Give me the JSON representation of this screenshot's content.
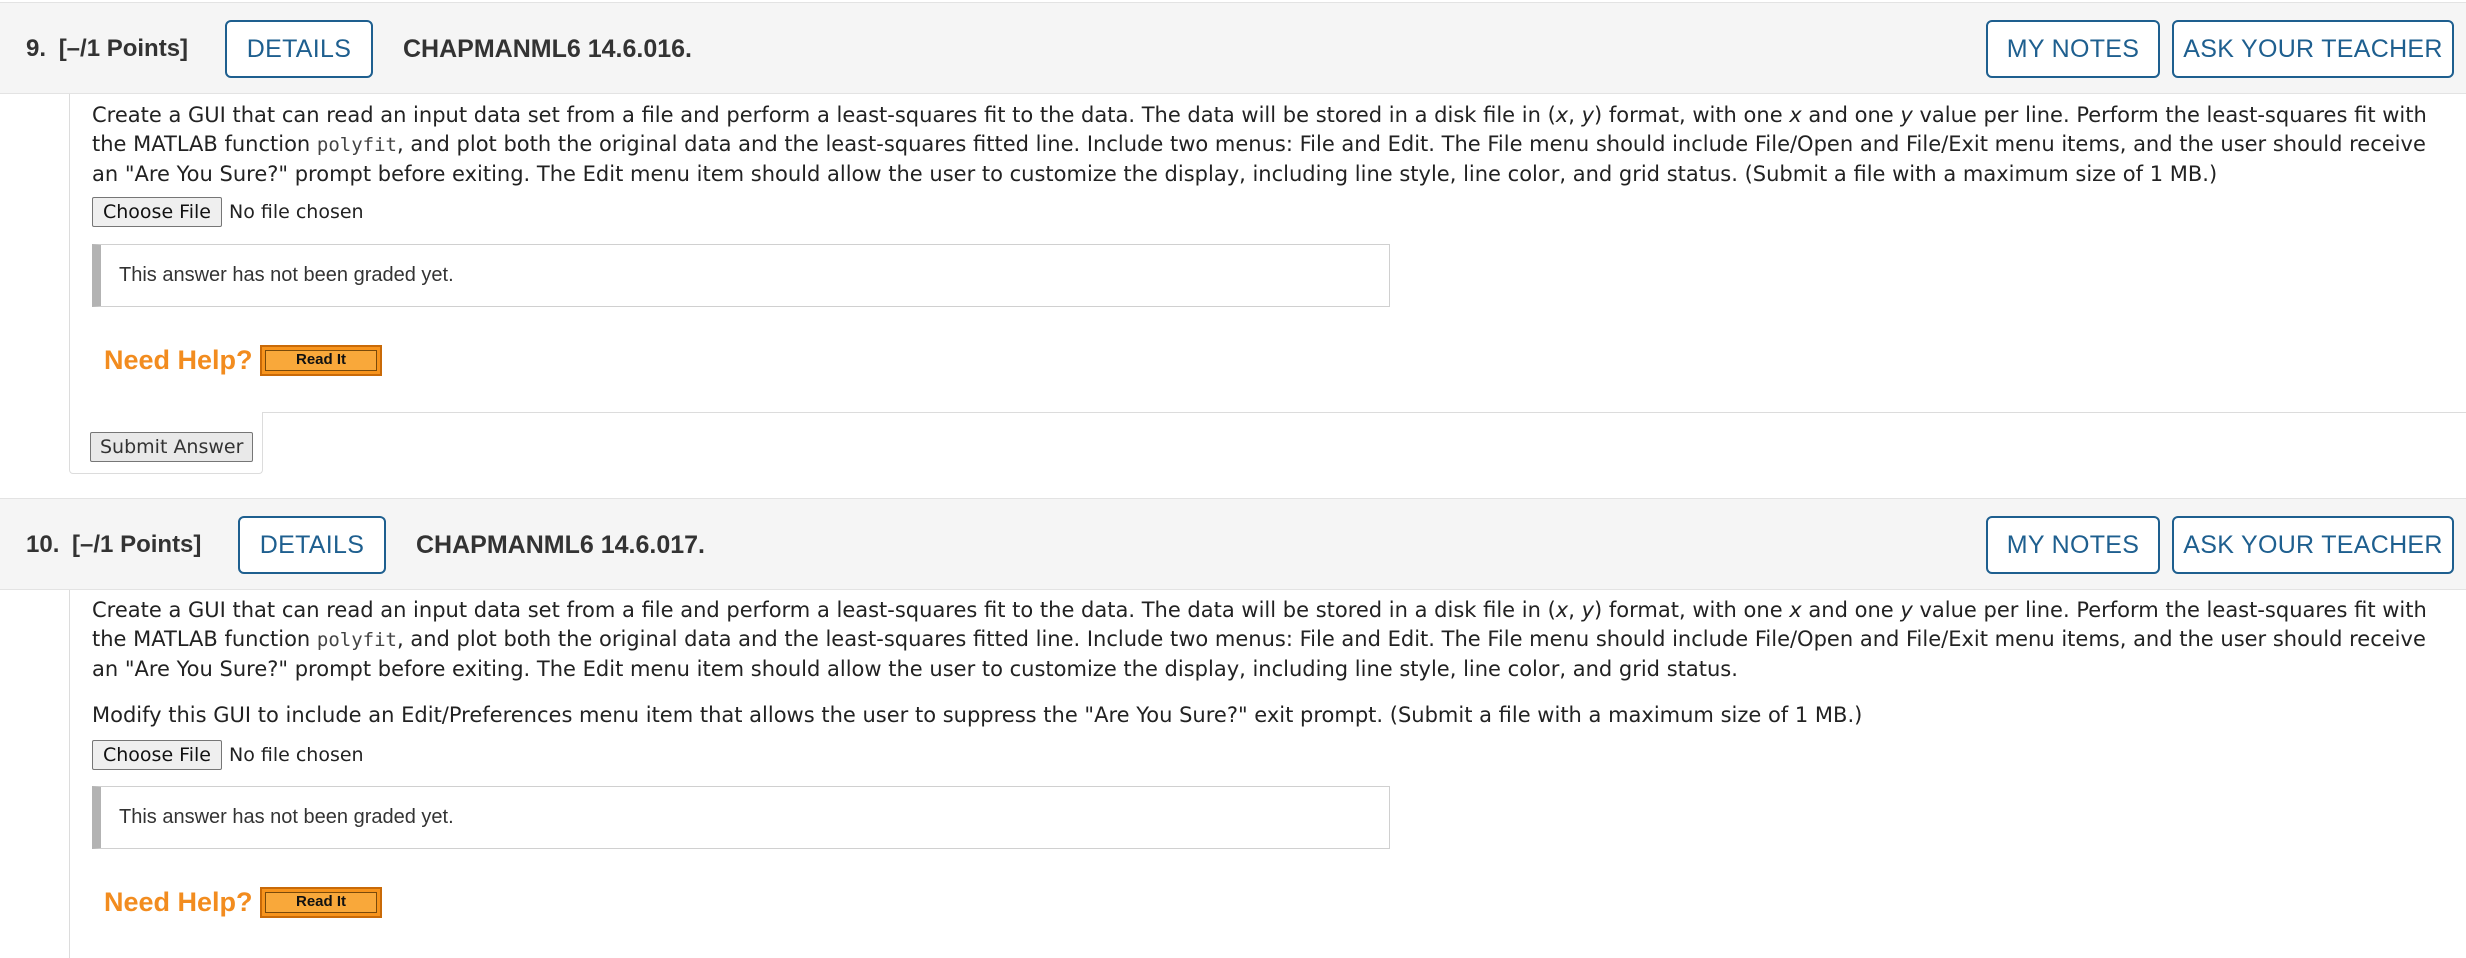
{
  "questions": [
    {
      "number": "9.",
      "points": "[–/1 Points]",
      "details_label": "DETAILS",
      "code": "CHAPMANML6 14.6.016.",
      "my_notes_label": "MY NOTES",
      "ask_teacher_label": "ASK YOUR TEACHER",
      "text_1": "Create a GUI that can read an input data set from a file and perform a least-squares fit to the data. The data will be stored in a disk file in (",
      "text_x": "x",
      "text_comma": ", ",
      "text_y": "y",
      "text_2": ") format, with one ",
      "text_x2": "x",
      "text_3": " and one ",
      "text_y2": "y",
      "text_4": " value per line. Perform the least-squares fit with the MATLAB function ",
      "code_word": "polyfit",
      "text_5": ", and plot both the original data and the least-squares fitted line. Include two menus: File and Edit. The File menu should include File/Open and File/Exit menu items, and the user should receive an \"Are You Sure?\" prompt before exiting. The Edit menu item should allow the user to customize the display, including line style, line color, and grid status. (Submit a file with a maximum size of 1 MB.)",
      "choose_file_label": "Choose File",
      "no_file_label": "No file chosen",
      "grade_status": "This answer has not been graded yet.",
      "need_help_label": "Need Help?",
      "read_it_label": "Read It",
      "submit_label": "Submit Answer"
    },
    {
      "number": "10.",
      "points": "[–/1 Points]",
      "details_label": "DETAILS",
      "code": "CHAPMANML6 14.6.017.",
      "my_notes_label": "MY NOTES",
      "ask_teacher_label": "ASK YOUR TEACHER",
      "text_1": "Create a GUI that can read an input data set from a file and perform a least-squares fit to the data. The data will be stored in a disk file in (",
      "text_x": "x",
      "text_comma": ", ",
      "text_y": "y",
      "text_2": ") format, with one ",
      "text_x2": "x",
      "text_3": " and one ",
      "text_y2": "y",
      "text_4": " value per line. Perform the least-squares fit with the MATLAB function ",
      "code_word": "polyfit",
      "text_5": ", and plot both the original data and the least-squares fitted line. Include two menus: File and Edit. The File menu should include File/Open and File/Exit menu items, and the user should receive an \"Are You Sure?\" prompt before exiting. The Edit menu item should allow the user to customize the display, including line style, line color, and grid status.",
      "text_modify": "Modify this GUI to include an Edit/Preferences menu item that allows the user to suppress the \"Are You Sure?\" exit prompt. (Submit a file with a maximum size of 1 MB.)",
      "choose_file_label": "Choose File",
      "no_file_label": "No file chosen",
      "grade_status": "This answer has not been graded yet.",
      "need_help_label": "Need Help?",
      "read_it_label": "Read It"
    }
  ],
  "colors": {
    "accent_blue": "#1e5f8f",
    "help_orange": "#f28c1f",
    "read_it_orange": "#f7941d",
    "header_bg": "#f5f5f5"
  }
}
